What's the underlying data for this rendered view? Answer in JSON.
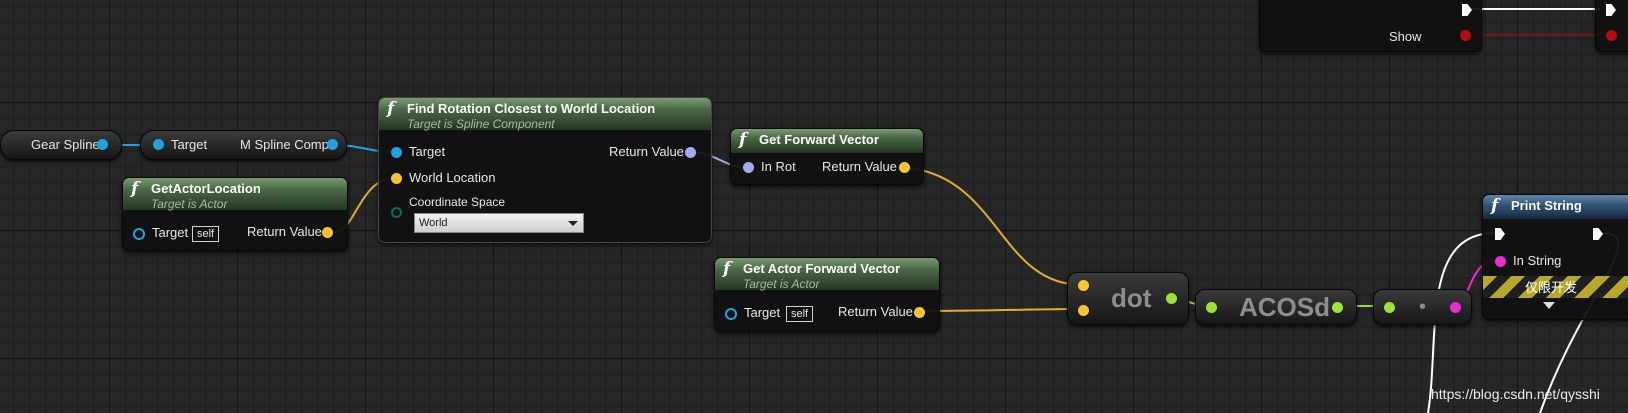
{
  "colors": {
    "object_pin": "#1fa3e0",
    "vector_pin": "#f7c531",
    "rotator_pin": "#a2aaf2",
    "float_pin": "#9be33a",
    "string_pin": "#f02ad2",
    "bool_pin": "#b00d0d",
    "exec_pin": "#ffffff",
    "enum_pin": "#0b6b5b"
  },
  "top_node": {
    "show_label": "Show"
  },
  "var_get": {
    "label": "Gear Spline"
  },
  "spline_get": {
    "target_label": "Target",
    "output_label": "M Spline Comp"
  },
  "get_actor_location": {
    "title": "GetActorLocation",
    "subtitle": "Target is Actor",
    "target_label": "Target",
    "self_label": "self",
    "return_label": "Return Value"
  },
  "find_rotation": {
    "title": "Find Rotation Closest to World Location",
    "subtitle": "Target is Spline Component",
    "target_label": "Target",
    "return_label": "Return Value",
    "world_location_label": "World Location",
    "coord_space_label": "Coordinate Space",
    "coord_space_value": "World"
  },
  "get_forward": {
    "title": "Get Forward Vector",
    "in_label": "In Rot",
    "return_label": "Return Value"
  },
  "get_actor_forward": {
    "title": "Get Actor Forward Vector",
    "subtitle": "Target is Actor",
    "target_label": "Target",
    "self_label": "self",
    "return_label": "Return Value"
  },
  "dot_node": {
    "label": "dot"
  },
  "acos_node": {
    "label": "ACOSd"
  },
  "reroute_node": {
    "label": "•"
  },
  "print_string": {
    "title": "Print String",
    "in_string_label": "In String",
    "dev_only_label": "仅限开发"
  },
  "watermark": "https://blog.csdn.net/qysshi"
}
